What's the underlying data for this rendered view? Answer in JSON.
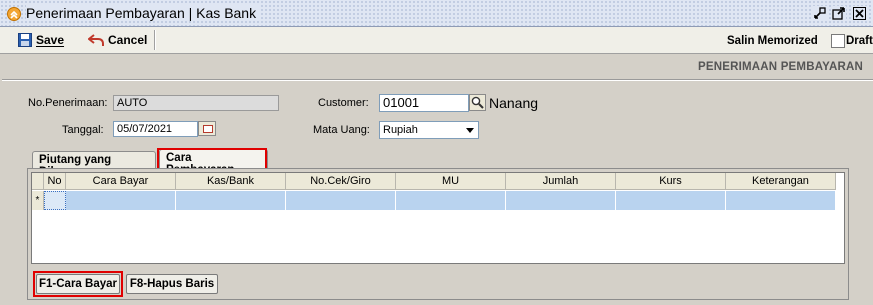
{
  "window": {
    "title": "Penerimaan Pembayaran | Kas Bank"
  },
  "toolbar": {
    "save_label": "Save",
    "cancel_label": "Cancel",
    "salin_label": "Salin Memorized",
    "draft_label": "Draft"
  },
  "section_title": "PENERIMAAN PEMBAYARAN",
  "form": {
    "no_penerimaan_label": "No.Penerimaan:",
    "no_penerimaan_value": "AUTO",
    "tanggal_label": "Tanggal:",
    "tanggal_value": "05/07/2021",
    "customer_label": "Customer:",
    "customer_value": "01001",
    "customer_name": "Nanang",
    "mata_uang_label": "Mata Uang:",
    "mata_uang_value": "Rupiah"
  },
  "tabs": [
    "Piutang yang Dibayar",
    "Cara Pembayaran"
  ],
  "grid": {
    "columns": [
      "No",
      "Cara Bayar",
      "Kas/Bank",
      "No.Cek/Giro",
      "MU",
      "Jumlah",
      "Kurs",
      "Keterangan"
    ],
    "new_row_marker": "*"
  },
  "buttons": {
    "cara_bayar": "F1-Cara Bayar",
    "hapus_baris": "F8-Hapus Baris"
  },
  "colors": {
    "highlight_red": "#e00000",
    "row_selected": "#b9d3ef",
    "title_icon": "#f3a533"
  }
}
